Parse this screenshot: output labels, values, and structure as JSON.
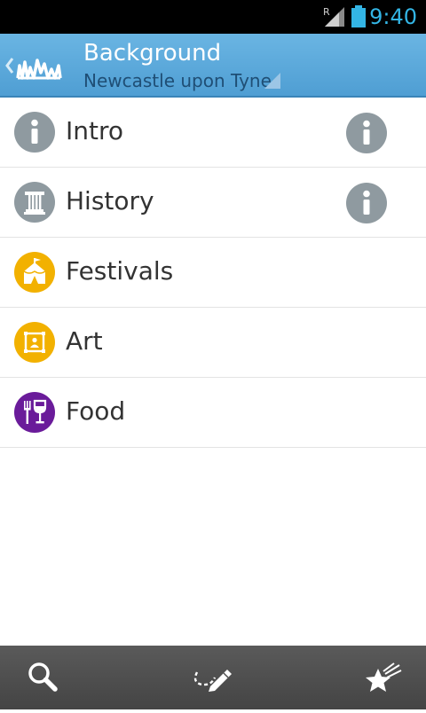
{
  "status_bar": {
    "time": "9:40",
    "roaming_indicator": "R",
    "signal_icon": "signal-icon",
    "battery_icon": "battery-icon",
    "accent_color": "#33b5e5"
  },
  "action_bar": {
    "title": "Background",
    "subtitle": "Newcastle upon Tyne",
    "app_icon": "skyline-icon",
    "background_color": "#5aa8dc"
  },
  "list": {
    "items": [
      {
        "label": "Intro",
        "icon": "info-icon",
        "icon_color": "#8f9aa0",
        "info_icon": true
      },
      {
        "label": "History",
        "icon": "column-icon",
        "icon_color": "#8f9aa0",
        "info_icon": true
      },
      {
        "label": "Festivals",
        "icon": "tent-icon",
        "icon_color": "#f2b100",
        "info_icon": false
      },
      {
        "label": "Art",
        "icon": "picture-frame-icon",
        "icon_color": "#f2b100",
        "info_icon": false
      },
      {
        "label": "Food",
        "icon": "fork-wine-icon",
        "icon_color": "#6a1b9a",
        "info_icon": false
      }
    ]
  },
  "bottom_bar": {
    "buttons": [
      "search-icon",
      "route-edit-icon",
      "favorites-star-icon"
    ],
    "background_color": "#4e4e4e"
  }
}
